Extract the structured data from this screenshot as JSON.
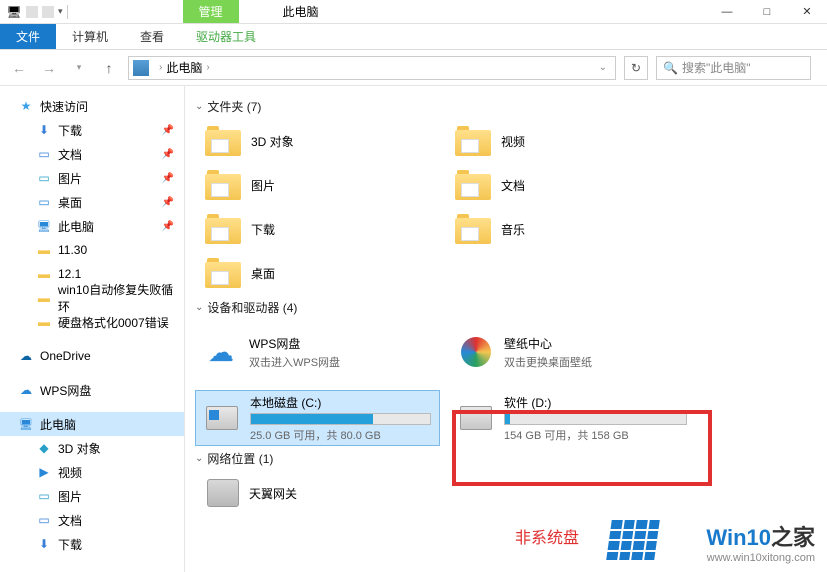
{
  "titlebar": {
    "context_tab": "管理",
    "title": "此电脑"
  },
  "window_controls": {
    "min": "—",
    "max": "□",
    "close": "✕"
  },
  "ribbon": {
    "file": "文件",
    "computer": "计算机",
    "view": "查看",
    "drive_tools": "驱动器工具"
  },
  "navbar": {
    "location": "此电脑",
    "search_placeholder": "搜索\"此电脑\""
  },
  "sidebar": {
    "quick_access": "快速访问",
    "items_quick": [
      {
        "icon": "ic-dl",
        "label": "下载",
        "pinned": true
      },
      {
        "icon": "ic-doc",
        "label": "文档",
        "pinned": true
      },
      {
        "icon": "ic-pic",
        "label": "图片",
        "pinned": true
      },
      {
        "icon": "ic-desk",
        "label": "桌面",
        "pinned": true
      },
      {
        "icon": "ic-pc",
        "label": "此电脑",
        "pinned": true
      },
      {
        "icon": "ic-folder",
        "label": "11.30",
        "pinned": false
      },
      {
        "icon": "ic-folder",
        "label": "12.1",
        "pinned": false
      },
      {
        "icon": "ic-folder",
        "label": "win10自动修复失败循环",
        "pinned": false
      },
      {
        "icon": "ic-folder",
        "label": "硬盘格式化0007错误",
        "pinned": false
      }
    ],
    "onedrive": "OneDrive",
    "wps": "WPS网盘",
    "this_pc": "此电脑",
    "pc_children": [
      {
        "icon": "ic-3d",
        "label": "3D 对象"
      },
      {
        "icon": "ic-vid",
        "label": "视频"
      },
      {
        "icon": "ic-pic",
        "label": "图片"
      },
      {
        "icon": "ic-doc",
        "label": "文档"
      },
      {
        "icon": "ic-dl",
        "label": "下载"
      }
    ]
  },
  "sections": {
    "folders": {
      "title": "文件夹 (7)"
    },
    "drives": {
      "title": "设备和驱动器 (4)"
    },
    "network": {
      "title": "网络位置 (1)"
    }
  },
  "folders_col1": [
    {
      "label": "3D 对象"
    },
    {
      "label": "图片"
    },
    {
      "label": "下载"
    },
    {
      "label": "桌面"
    }
  ],
  "folders_col2": [
    {
      "label": "视频"
    },
    {
      "label": "文档"
    },
    {
      "label": "音乐"
    }
  ],
  "drives": {
    "wps": {
      "title": "WPS网盘",
      "sub": "双击进入WPS网盘"
    },
    "wallpaper": {
      "title": "壁纸中心",
      "sub": "双击更换桌面壁纸"
    },
    "c": {
      "title": "本地磁盘 (C:)",
      "sub": "25.0 GB 可用，共 80.0 GB",
      "fill": 68
    },
    "d": {
      "title": "软件 (D:)",
      "sub": "154 GB 可用，共 158 GB",
      "fill": 3
    }
  },
  "network_item": "天翼网关",
  "annotation": "非系统盘",
  "watermark": {
    "brand1": "Win10",
    "brand2": "之家",
    "url": "www.win10xitong.com"
  }
}
